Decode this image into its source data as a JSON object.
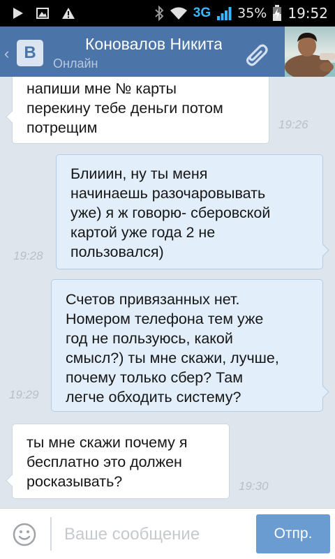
{
  "status_bar": {
    "network": "3G",
    "battery": "35%",
    "time": "19:52"
  },
  "header": {
    "contact_name": "Коновалов Никита",
    "status": "Онлайн",
    "back_icon": "‹",
    "logo_text": "B",
    "accent_color": "#4b74a8"
  },
  "messages": [
    {
      "direction": "in",
      "text": "напиши мне № карты\nперекину тебе деньги потом\nпотрещим",
      "time": "19:26"
    },
    {
      "direction": "out",
      "text": "Блииин, ну ты меня\nначинаешь разочаровывать\nуже) я ж говорю-  сберовской\nкартой уже года 2 не\nпользовался)",
      "time": "19:28"
    },
    {
      "direction": "out",
      "text": "Счетов привязанных нет.\nНомером телефона тем уже\nгод не пользуюсь, какой\nсмысл?) ты мне скажи, лучше,\nпочему только сбер? Там\nлегче обходить систему?",
      "time": "19:29"
    },
    {
      "direction": "in",
      "text": "ты мне скажи почему я\nбесплатно это должен\nросказывать?",
      "time": "19:30"
    }
  ],
  "composer": {
    "placeholder": "Ваше сообщение",
    "value": "",
    "send_label": "Отпр."
  }
}
